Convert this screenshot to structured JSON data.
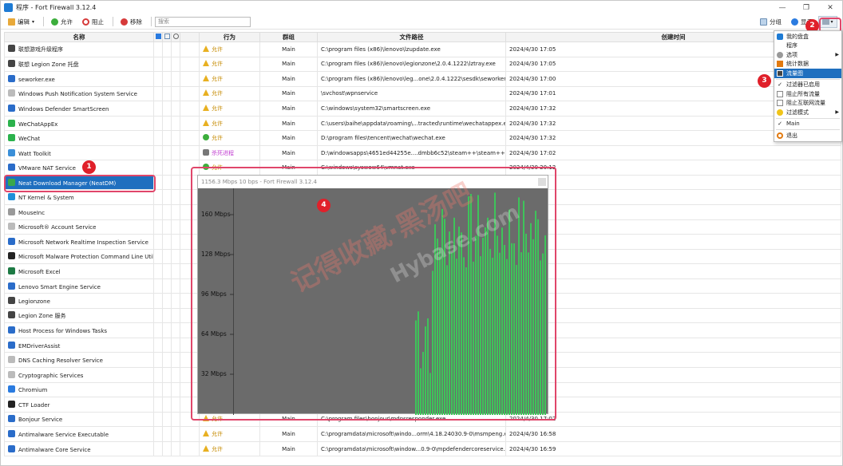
{
  "window": {
    "title": "程序 - Fort Firewall 3.12.4"
  },
  "toolbar": {
    "edit_label": "编辑",
    "allow_label": "允许",
    "block_label": "阻止",
    "remove_label": "移除",
    "search_placeholder": "搜索",
    "group_label": "分组",
    "display_label": "显示"
  },
  "table": {
    "headers": {
      "name": "名称",
      "action": "行为",
      "group": "群组",
      "path": "文件路径",
      "created": "创建时间"
    },
    "rows": [
      {
        "name": "联想游戏升级程序",
        "action": "允许",
        "action_type": "warn",
        "group": "Main",
        "path": "C:\\program files (x86)\\lenovo\\lzupdate.exe",
        "created": "2024/4/30 17:05",
        "icon_color": "#444"
      },
      {
        "name": "联想 Legion Zone 托盘",
        "action": "允许",
        "action_type": "warn",
        "group": "Main",
        "path": "C:\\program files (x86)\\lenovo\\legionzone\\2.0.4.1222\\lztray.exe",
        "created": "2024/4/30 17:05",
        "icon_color": "#444"
      },
      {
        "name": "seworker.exe",
        "action": "允许",
        "action_type": "warn",
        "group": "Main",
        "path": "C:\\program files (x86)\\lenovo\\leg...one\\2.0.4.1222\\sesdk\\seworker.exe",
        "created": "2024/4/30 17:00",
        "icon_color": "#2a6cc9"
      },
      {
        "name": "Windows Push Notification System Service",
        "action": "允许",
        "action_type": "warn",
        "group": "Main",
        "path": "\\svchost\\wpnservice",
        "created": "2024/4/30 17:01",
        "icon_color": "#bbb"
      },
      {
        "name": "Windows Defender SmartScreen",
        "action": "允许",
        "action_type": "warn",
        "group": "Main",
        "path": "C:\\windows\\system32\\smartscreen.exe",
        "created": "2024/4/30 17:32",
        "icon_color": "#2a6cc9"
      },
      {
        "name": "WeChatAppEx",
        "action": "允许",
        "action_type": "warn",
        "group": "Main",
        "path": "C:\\users\\baihe\\appdata\\roaming\\...tracted\\runtime\\wechatappex.exe",
        "created": "2024/4/30 17:32",
        "icon_color": "#2bb24c"
      },
      {
        "name": "WeChat",
        "action": "允许",
        "action_type": "ok",
        "group": "Main",
        "path": "D:\\program files\\tencent\\wechat\\wechat.exe",
        "created": "2024/4/30 17:32",
        "icon_color": "#2bb24c"
      },
      {
        "name": "Watt Toolkit",
        "action": "杀死进程",
        "action_type": "kill",
        "group": "Main",
        "path": "D:\\windowsapps\\4651ed44255e....dmbb6c52\\steam++\\steam++.exe",
        "created": "2024/4/30 17:02",
        "icon_color": "#3a8fd8"
      },
      {
        "name": "VMware NAT Service",
        "action": "允许",
        "action_type": "ok",
        "group": "Main",
        "path": "C:\\windows\\syswow64\\vmnat.exe",
        "created": "2024/4/30 20:12",
        "icon_color": "#2a6cc9"
      },
      {
        "name": "Neat Download Manager (NeatDM)",
        "action": "",
        "action_type": "",
        "group": "",
        "path": "",
        "created": "",
        "icon_color": "#3aa84a"
      },
      {
        "name": "NT Kernel & System",
        "action": "",
        "action_type": "",
        "group": "",
        "path": "",
        "created": "",
        "icon_color": "#1f8fd8"
      },
      {
        "name": "MouseInc",
        "action": "",
        "action_type": "",
        "group": "",
        "path": "",
        "created": "",
        "icon_color": "#999"
      },
      {
        "name": "Microsoft® Account Service",
        "action": "",
        "action_type": "",
        "group": "",
        "path": "",
        "created": "",
        "icon_color": "#bbb"
      },
      {
        "name": "Microsoft Network Realtime Inspection Service",
        "action": "",
        "action_type": "",
        "group": "",
        "path": "",
        "created": "",
        "icon_color": "#2a6cc9"
      },
      {
        "name": "Microsoft Malware Protection Command Line Utility",
        "action": "",
        "action_type": "",
        "group": "",
        "path": "",
        "created": "",
        "icon_color": "#222"
      },
      {
        "name": "Microsoft Excel",
        "action": "",
        "action_type": "",
        "group": "",
        "path": "",
        "created": "",
        "icon_color": "#1d7a44"
      },
      {
        "name": "Lenovo Smart Engine Service",
        "action": "",
        "action_type": "",
        "group": "",
        "path": "",
        "created": "",
        "icon_color": "#2a6cc9"
      },
      {
        "name": "Legionzone",
        "action": "",
        "action_type": "",
        "group": "",
        "path": "",
        "created": "",
        "icon_color": "#444"
      },
      {
        "name": "Legion Zone 服务",
        "action": "",
        "action_type": "",
        "group": "",
        "path": "",
        "created": "",
        "icon_color": "#444"
      },
      {
        "name": "Host Process for Windows Tasks",
        "action": "",
        "action_type": "",
        "group": "",
        "path": "",
        "created": "",
        "icon_color": "#2a6cc9"
      },
      {
        "name": "EMDriverAssist",
        "action": "",
        "action_type": "",
        "group": "",
        "path": "",
        "created": "",
        "icon_color": "#2a6cc9"
      },
      {
        "name": "DNS Caching Resolver Service",
        "action": "",
        "action_type": "",
        "group": "",
        "path": "",
        "created": "",
        "icon_color": "#bbb"
      },
      {
        "name": "Cryptographic Services",
        "action": "",
        "action_type": "",
        "group": "",
        "path": "",
        "created": "",
        "icon_color": "#bbb"
      },
      {
        "name": "Chromium",
        "action": "",
        "action_type": "",
        "group": "",
        "path": "",
        "created": "",
        "icon_color": "#2a7be0"
      },
      {
        "name": "CTF Loader",
        "action": "",
        "action_type": "",
        "group": "",
        "path": "",
        "created": "",
        "icon_color": "#222"
      },
      {
        "name": "Bonjour Service",
        "action": "允许",
        "action_type": "warn",
        "group": "Main",
        "path": "C:\\program files\\bonjour\\mdnsresponder.exe",
        "created": "2024/4/30 17:02",
        "icon_color": "#2a6cc9"
      },
      {
        "name": "Antimalware Service Executable",
        "action": "允许",
        "action_type": "warn",
        "group": "Main",
        "path": "C:\\programdata\\microsoft\\windo...orm\\4.18.24030.9-0\\msmpeng.exe",
        "created": "2024/4/30 16:58",
        "icon_color": "#2a6cc9"
      },
      {
        "name": "Antimalware Core Service",
        "action": "允许",
        "action_type": "warn",
        "group": "Main",
        "path": "C:\\programdata\\microsoft\\window...0.9-0\\mpdefendercoreservice.exe",
        "created": "2024/4/30 16:59",
        "icon_color": "#2a6cc9"
      }
    ]
  },
  "graph": {
    "title": "1156.3 Mbps 10 bps - Fort Firewall 3.12.4",
    "y_ticks": [
      "160 Mbps",
      "128 Mbps",
      "96 Mbps",
      "64 Mbps",
      "32 Mbps"
    ],
    "bar_color": "#3ec45a",
    "bg_color": "#6b6b6b"
  },
  "menu": {
    "items": [
      {
        "label": "我的盘盒",
        "icon": "app-icon",
        "has_sub": false
      },
      {
        "label": "程序",
        "icon": "blank",
        "has_sub": false
      },
      {
        "label": "选项",
        "icon": "gear-icon",
        "has_sub": true
      },
      {
        "label": "统计数据",
        "icon": "stats-icon",
        "has_sub": false
      },
      {
        "label": "流量图",
        "icon": "graph-icon",
        "has_sub": false,
        "highlight": true
      },
      {
        "label": "过滤器已启用",
        "icon": "check",
        "has_sub": false
      },
      {
        "label": "阻止所有流量",
        "icon": "box",
        "has_sub": false
      },
      {
        "label": "阻止互联网流量",
        "icon": "box",
        "has_sub": false
      },
      {
        "label": "过滤模式",
        "icon": "bulb-icon",
        "has_sub": true
      },
      {
        "label": "Main",
        "icon": "check",
        "has_sub": false
      },
      {
        "label": "退出",
        "icon": "power-icon",
        "has_sub": false
      }
    ]
  },
  "badges": [
    "1",
    "2",
    "3",
    "4"
  ],
  "watermark": {
    "text1": "记得收藏·黑汤吧",
    "text2": "Hybase.com"
  },
  "colors": {
    "accent": "#1f6fbf",
    "annotation": "#e0466a",
    "badge": "#e0202a"
  }
}
